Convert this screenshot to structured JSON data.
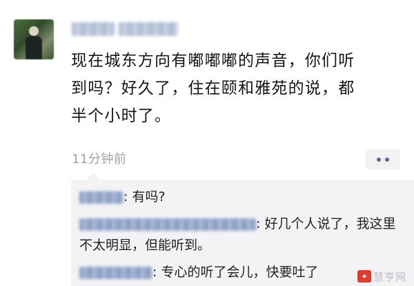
{
  "post": {
    "text": "现在城东方向有嘟嘟嘟的声音，你们听\n到吗？好久了，住在颐和雅苑的说，都\n半个小时了。",
    "time": "11分钟前"
  },
  "comments": [
    {
      "text": ": 有吗?"
    },
    {
      "text": ": 好几个人说了，我这里不太明显，但能听到。"
    },
    {
      "text": ": 专心的听了会儿，快要吐了"
    }
  ],
  "watermark": {
    "text": "慧亨网"
  },
  "icons": {
    "more": "more-dots-icon"
  },
  "colors": {
    "link_blue": "#576b95",
    "time_gray": "#a3a3a3",
    "comment_bg": "#f3f3f5"
  }
}
